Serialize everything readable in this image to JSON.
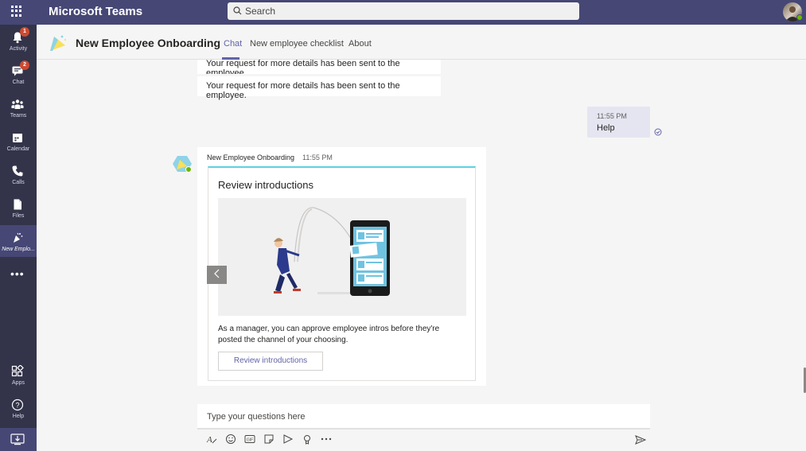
{
  "app": {
    "title": "Microsoft Teams"
  },
  "search": {
    "placeholder": "Search"
  },
  "rail": {
    "items": [
      {
        "label": "Activity",
        "badge": "1"
      },
      {
        "label": "Chat",
        "badge": "2"
      },
      {
        "label": "Teams"
      },
      {
        "label": "Calendar"
      },
      {
        "label": "Calls"
      },
      {
        "label": "Files"
      },
      {
        "label": "New Emplo..."
      }
    ],
    "bottom_items": [
      {
        "label": "Apps"
      },
      {
        "label": "Help"
      }
    ]
  },
  "header": {
    "title": "New Employee Onboarding",
    "tabs": [
      {
        "label": "Chat"
      },
      {
        "label": "New employee checklist"
      },
      {
        "label": "About"
      }
    ]
  },
  "messages": {
    "bot_notice_1": "Your request for more details has been sent to the employee.",
    "bot_notice_2": "Your request for more details has been sent to the employee.",
    "my_message": {
      "time": "11:55 PM",
      "text": "Help"
    },
    "bot_card_message": {
      "sender": "New Employee Onboarding",
      "time": "11:55 PM",
      "card": {
        "title": "Review introductions",
        "description": "As a manager, you can approve employee intros before they're posted the channel of your choosing.",
        "button_label": "Review introductions"
      }
    }
  },
  "compose": {
    "placeholder": "Type your questions here"
  },
  "colors": {
    "brand": "#464775",
    "rail": "#33344a",
    "accent": "#6264a7",
    "status_online": "#6bb700",
    "badge": "#cc4a31"
  }
}
